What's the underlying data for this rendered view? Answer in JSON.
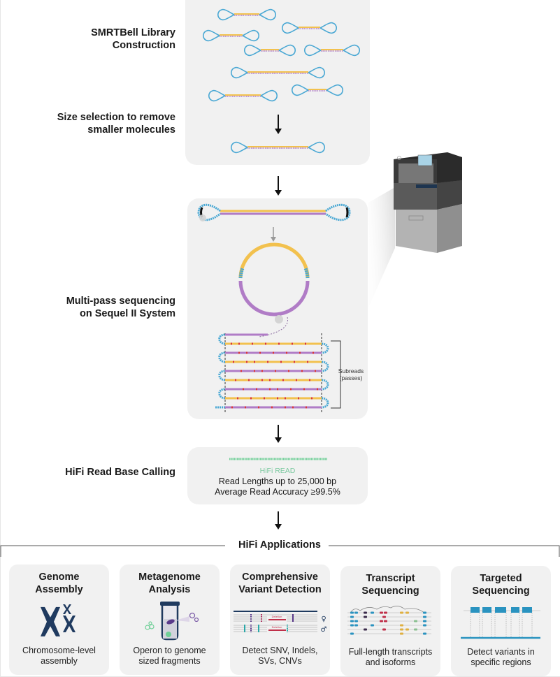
{
  "steps": {
    "library": {
      "line1": "SMRTBell Library",
      "line2": "Construction"
    },
    "size_selection": {
      "line1": "Size selection to remove",
      "line2": "smaller molecules"
    },
    "multipass": {
      "line1": "Multi-pass sequencing",
      "line2": "on Sequel II System"
    },
    "base_calling": {
      "label": "HiFi Read Base Calling"
    }
  },
  "subreads_label": {
    "line1": "Subreads",
    "line2": "(passes)"
  },
  "hifi_read": {
    "title": "HiFi READ",
    "read_lengths": "Read Lengths up to 25,000 bp",
    "accuracy": "Average Read Accuracy ≥99.5%"
  },
  "applications": {
    "title": "HiFi Applications",
    "cards": [
      {
        "title_l1": "Genome",
        "title_l2": "Assembly",
        "desc_l1": "Chromosome-level",
        "desc_l2": "assembly",
        "icon": "chromosome-icon"
      },
      {
        "title_l1": "Metagenome",
        "title_l2": "Analysis",
        "desc_l1": "Operon to genome",
        "desc_l2": "sized fragments",
        "icon": "test-tube-microbes-icon"
      },
      {
        "title_l1": "Comprehensive",
        "title_l2": "Variant Detection",
        "desc_l1": "Detect SNV, Indels,",
        "desc_l2": "SVs, CNVs",
        "icon": "variant-tracks-icon",
        "deletion_label": "Deletion",
        "female_symbol": "♀",
        "male_symbol": "♂"
      },
      {
        "title_l1": "Transcript",
        "title_l2": "Sequencing",
        "desc_l1": "Full-length transcripts",
        "desc_l2": "and isoforms",
        "icon": "isoform-tracks-icon"
      },
      {
        "title_l1": "Targeted",
        "title_l2": "Sequencing",
        "desc_l1": "Detect variants in",
        "desc_l2": "specific regions",
        "icon": "target-regions-icon"
      }
    ]
  },
  "colors": {
    "adapter_blue": "#4aa8d4",
    "insert_yellow": "#f2c14e",
    "insert_purple": "#b07cc6",
    "error_red": "#d9373b",
    "hifi_green": "#6fcf97",
    "panel_bg": "#f1f1f1",
    "chromosome_navy": "#1f3a5f"
  }
}
